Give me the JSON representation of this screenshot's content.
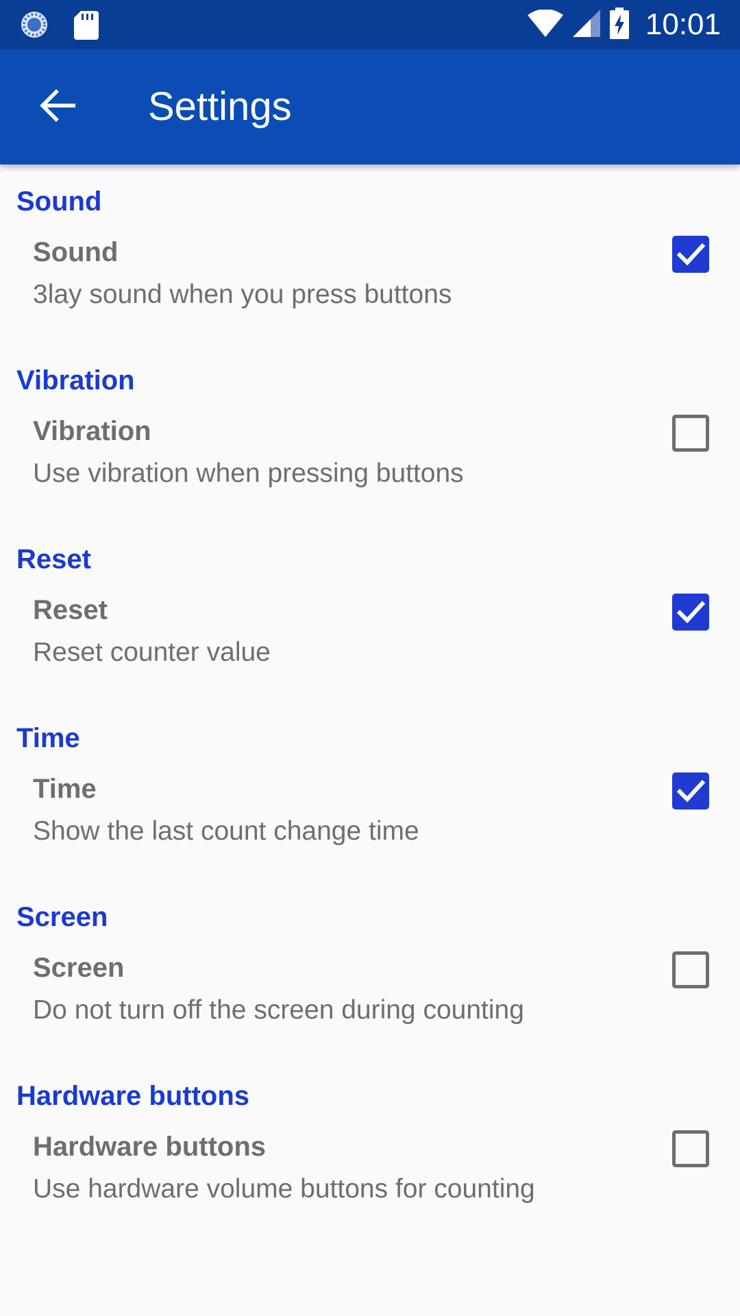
{
  "status_bar": {
    "time": "10:01",
    "icons": [
      "sync-icon",
      "sd-card-icon",
      "wifi-icon",
      "signal-icon",
      "battery-charging-icon"
    ]
  },
  "app_bar": {
    "title": "Settings",
    "back_icon": "arrow-back-icon"
  },
  "colors": {
    "status_bar": "#0a3e96",
    "app_bar": "#0b4db5",
    "accent": "#1f3bd2",
    "section_header": "#1a3ad2",
    "text_secondary": "#6e6e6e",
    "background": "#fafafa"
  },
  "sections": [
    {
      "header": "Sound",
      "title": "Sound",
      "summary": "3lay sound when you press buttons",
      "checked": true
    },
    {
      "header": "Vibration",
      "title": "Vibration",
      "summary": "Use vibration when pressing buttons",
      "checked": false
    },
    {
      "header": "Reset",
      "title": "Reset",
      "summary": "Reset counter value",
      "checked": true
    },
    {
      "header": "Time",
      "title": "Time",
      "summary": "Show the last count change time",
      "checked": true
    },
    {
      "header": "Screen",
      "title": "Screen",
      "summary": "Do not turn off the screen during counting",
      "checked": false
    },
    {
      "header": "Hardware buttons",
      "title": "Hardware buttons",
      "summary": "Use hardware volume buttons for counting",
      "checked": false
    }
  ]
}
